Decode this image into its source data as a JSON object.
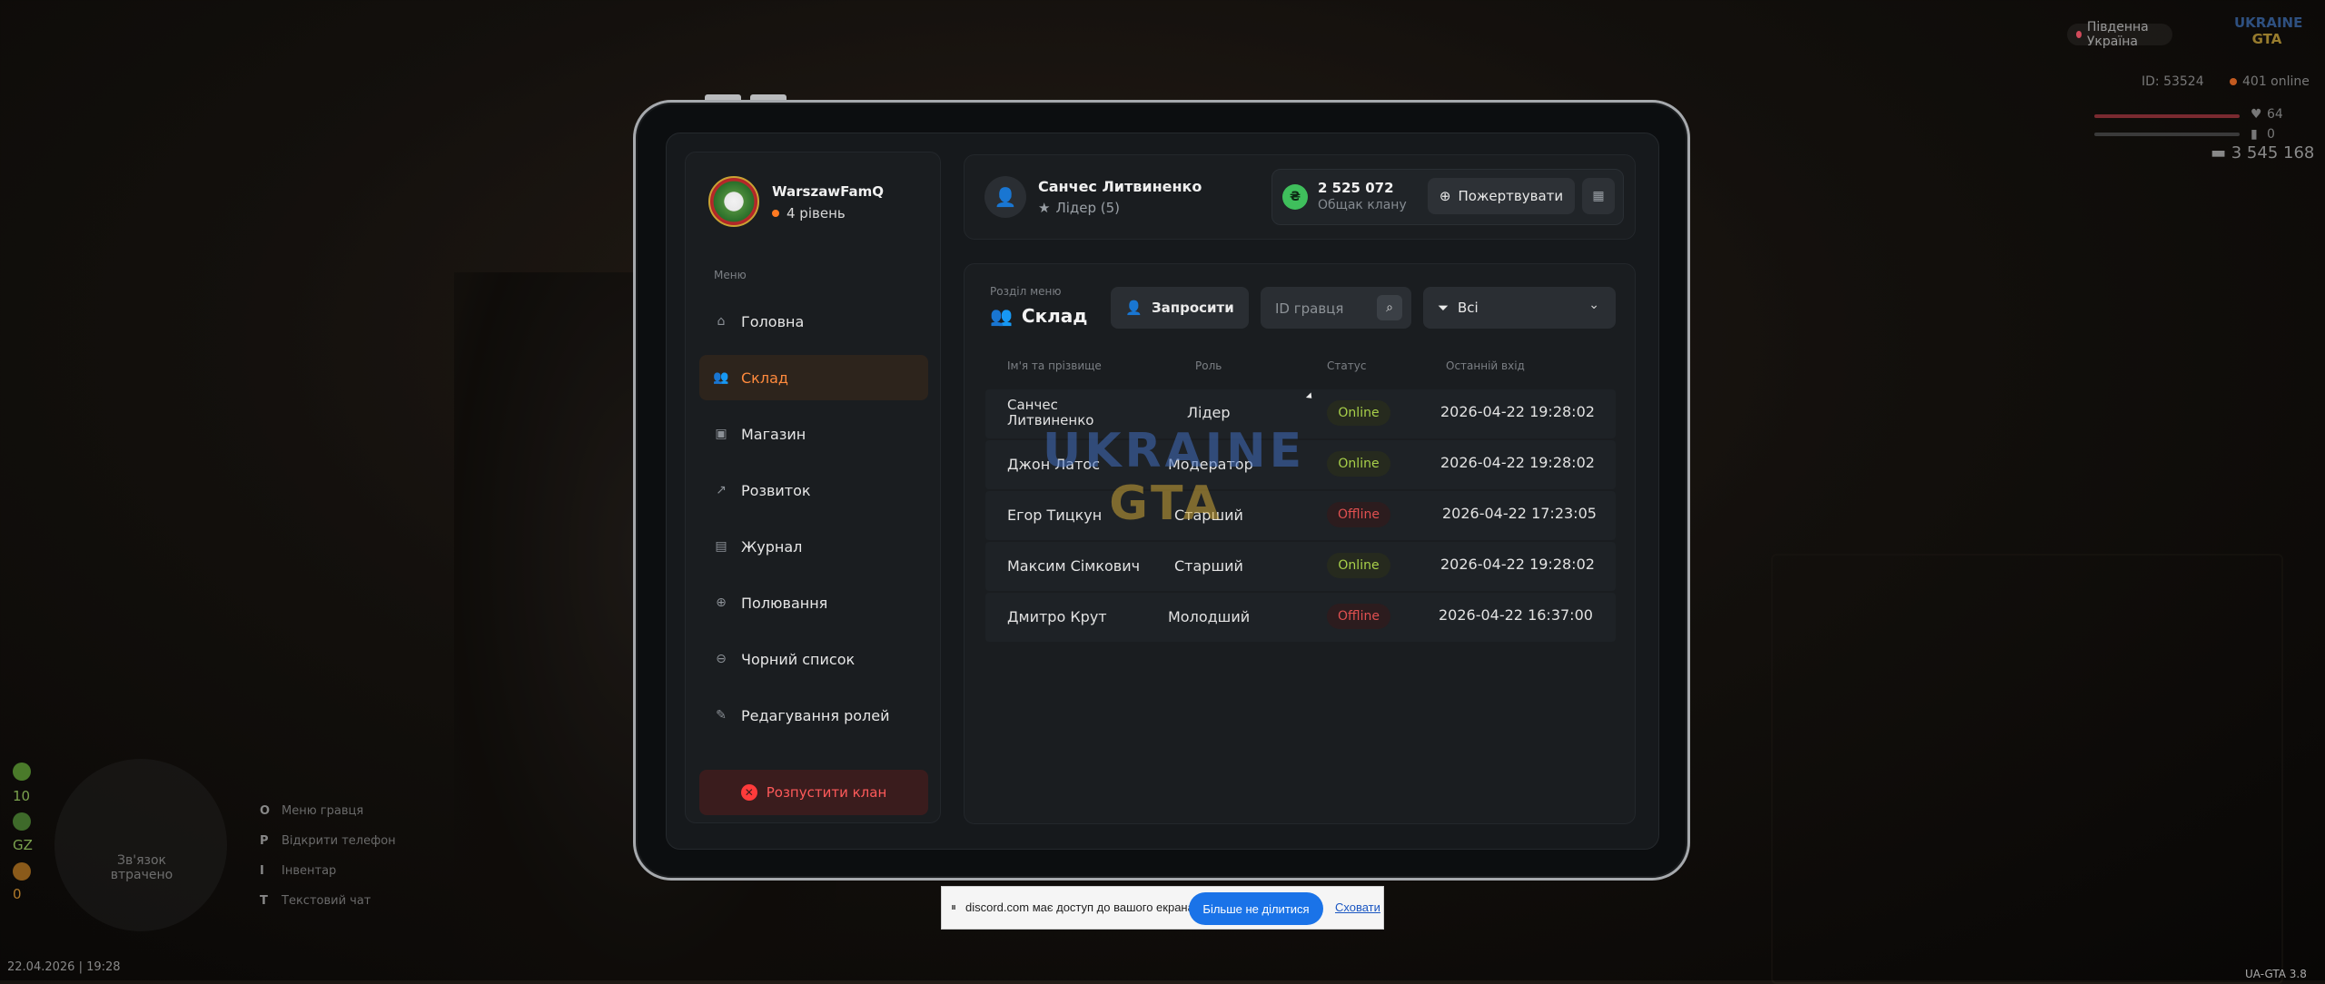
{
  "hud": {
    "server": "Південна Україна",
    "logo_top": "UKRAINE",
    "logo_bottom": "GTA",
    "player_id": "ID: 53524",
    "online": "401 online",
    "health": "64",
    "armor": "0",
    "money": "3 545 168",
    "left_values": [
      "10",
      "GZ",
      "0"
    ],
    "minimap_text": "Зв'язок втрачено",
    "keys": [
      {
        "key": "O",
        "label": "Меню гравця"
      },
      {
        "key": "P",
        "label": "Відкрити телефон"
      },
      {
        "key": "I",
        "label": "Інвентар"
      },
      {
        "key": "T",
        "label": "Текстовий чат"
      }
    ],
    "datetime": "22.04.2026 | 19:28",
    "version": "UA-GTA 3.8"
  },
  "clan": {
    "name": "WarszawFamQ",
    "level": "4 рівень"
  },
  "menu": {
    "label": "Меню",
    "items": [
      {
        "label": "Головна",
        "icon": "home-icon"
      },
      {
        "label": "Склад",
        "icon": "people-icon"
      },
      {
        "label": "Магазин",
        "icon": "shop-icon"
      },
      {
        "label": "Розвиток",
        "icon": "chart-icon"
      },
      {
        "label": "Журнал",
        "icon": "book-icon"
      },
      {
        "label": "Полювання",
        "icon": "target-icon"
      },
      {
        "label": "Чорний список",
        "icon": "block-icon"
      },
      {
        "label": "Редагування ролей",
        "icon": "user-edit-icon"
      }
    ],
    "active_index": 1,
    "disband": "Розпустити клан"
  },
  "leader": {
    "name": "Санчес Литвиненко",
    "role": "Лідер (5)"
  },
  "treasury": {
    "amount": "2 525 072",
    "label": "Общак клану",
    "donate": "Пожертвувати"
  },
  "section": {
    "label": "Розділ меню",
    "title": "Склад",
    "invite": "Запросити",
    "search_placeholder": "ID гравця",
    "filter": "Всі"
  },
  "table": {
    "headers": [
      "Ім'я та прізвище",
      "Роль",
      "Статус",
      "Останній вхід"
    ],
    "rows": [
      {
        "name": "Санчес Литвиненко",
        "role": "Лідер",
        "status": "Online",
        "last": "2026-04-22 19:28:02"
      },
      {
        "name": "Джон Латос",
        "role": "Модератор",
        "status": "Online",
        "last": "2026-04-22 19:28:02"
      },
      {
        "name": "Егор Тицкун",
        "role": "Старший",
        "status": "Offline",
        "last": "2026-04-22 17:23:05"
      },
      {
        "name": "Максим Сімкович",
        "role": "Старший",
        "status": "Online",
        "last": "2026-04-22 19:28:02"
      },
      {
        "name": "Дмитро Крут",
        "role": "Молодший",
        "status": "Offline",
        "last": "2026-04-22 16:37:00"
      }
    ]
  },
  "watermark": {
    "top": "UKRAINE",
    "bottom": "GTA"
  },
  "share_bar": {
    "message": "discord.com має доступ до вашого екрана.",
    "stop": "Більше не ділитися",
    "hide": "Сховати"
  },
  "colors": {
    "accent": "#ff8a3d",
    "online": "#a8d04a",
    "offline": "#e05050",
    "danger": "#ff5a5a"
  }
}
